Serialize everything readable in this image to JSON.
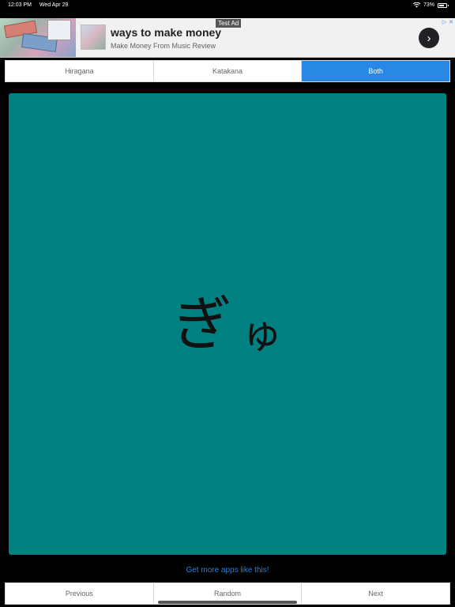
{
  "status": {
    "time": "12:03 PM",
    "date": "Wed Apr 29",
    "battery": "73%",
    "battery_level": 0.73
  },
  "ad": {
    "label": "Test Ad",
    "title": "ways to make money",
    "subtitle": "Make Money From Music Review",
    "cta_icon": "chevron-right-icon",
    "choices_icon": "ad-choices-icon",
    "close_icon": "close-icon"
  },
  "segments": [
    {
      "label": "Hiragana",
      "active": false
    },
    {
      "label": "Katakana",
      "active": false
    },
    {
      "label": "Both",
      "active": true
    }
  ],
  "card": {
    "kana_main": "ぎ",
    "kana_small": "ゅ",
    "color": "#008080"
  },
  "links": {
    "more_apps": "Get more apps like this!"
  },
  "navigation": {
    "previous": "Previous",
    "random": "Random",
    "next": "Next"
  },
  "colors": {
    "accent": "#2a88e5",
    "card": "#008080",
    "background": "#000000"
  }
}
